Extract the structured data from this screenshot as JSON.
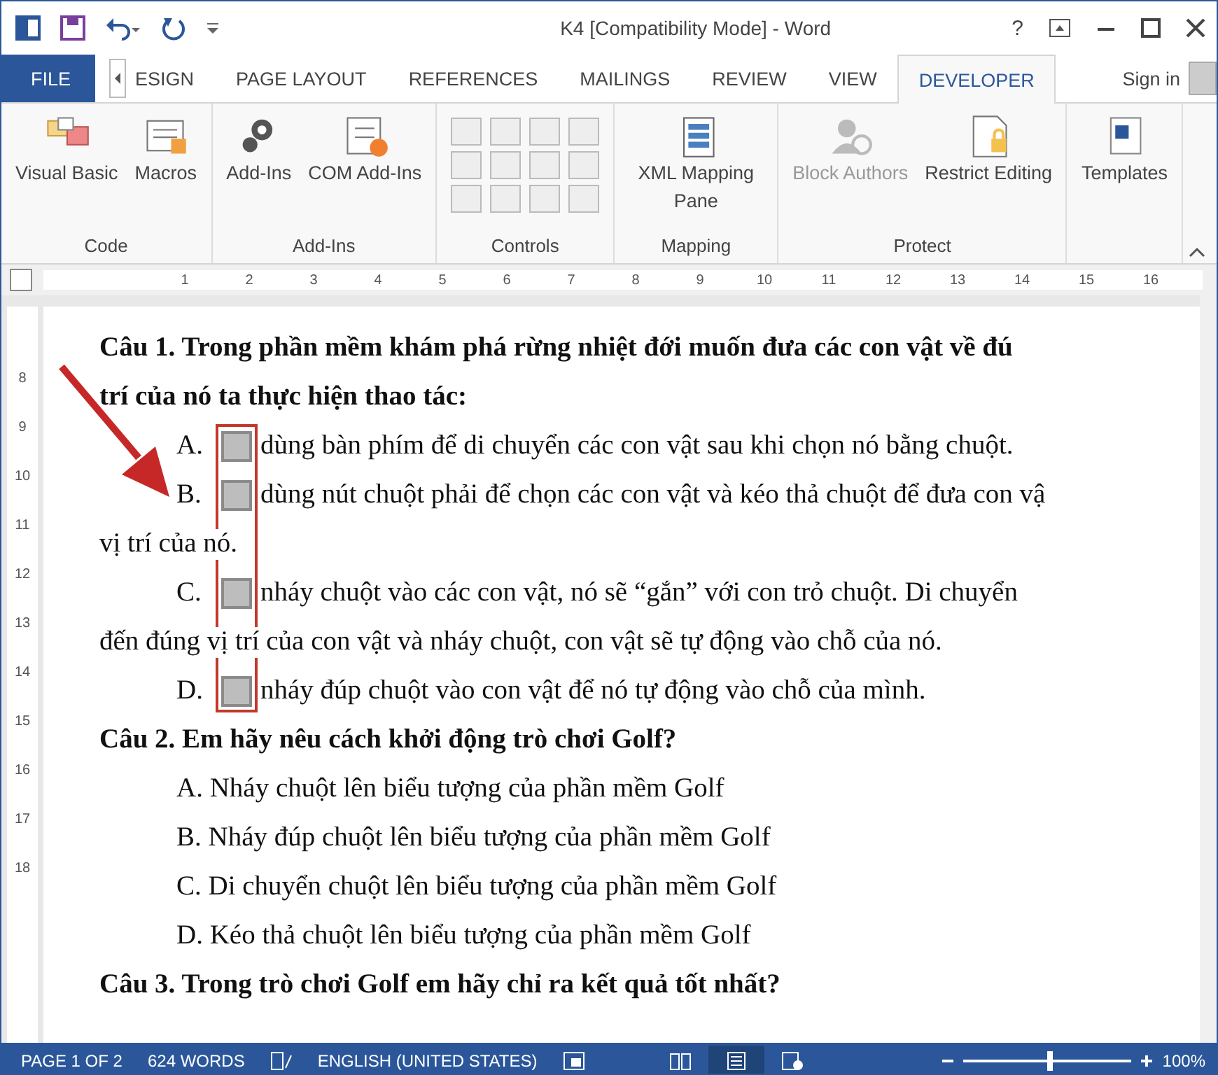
{
  "window": {
    "title": "K4 [Compatibility Mode] - Word",
    "help": "?"
  },
  "tabs": [
    {
      "label": "FILE",
      "kind": "file",
      "selected": false
    },
    {
      "label": "ESIGN",
      "kind": "scrolled",
      "selected": false
    },
    {
      "label": "PAGE LAYOUT",
      "kind": "tab",
      "selected": false
    },
    {
      "label": "REFERENCES",
      "kind": "tab",
      "selected": false
    },
    {
      "label": "MAILINGS",
      "kind": "tab",
      "selected": false
    },
    {
      "label": "REVIEW",
      "kind": "tab",
      "selected": false
    },
    {
      "label": "VIEW",
      "kind": "tab",
      "selected": false
    },
    {
      "label": "DEVELOPER",
      "kind": "tab",
      "selected": true
    }
  ],
  "sign_in": "Sign in",
  "ribbon": {
    "groups": [
      {
        "label": "Code",
        "buttons": [
          {
            "label": "Visual Basic",
            "disabled": false
          },
          {
            "label": "Macros",
            "disabled": false
          }
        ]
      },
      {
        "label": "Add-Ins",
        "buttons": [
          {
            "label": "Add-Ins",
            "disabled": false
          },
          {
            "label": "COM Add-Ins",
            "disabled": false
          }
        ]
      },
      {
        "label": "Controls"
      },
      {
        "label": "Mapping",
        "buttons": [
          {
            "label": "XML Mapping Pane",
            "disabled": false
          }
        ]
      },
      {
        "label": "Protect",
        "buttons": [
          {
            "label": "Block Authors",
            "disabled": true
          },
          {
            "label": "Restrict Editing",
            "disabled": false
          }
        ]
      },
      {
        "buttons": [
          {
            "label": "Templates",
            "disabled": false
          }
        ]
      }
    ]
  },
  "ruler": {
    "ticks": [
      "1",
      "2",
      "3",
      "4",
      "5",
      "6",
      "7",
      "8",
      "9",
      "10",
      "11",
      "12",
      "13",
      "14",
      "15",
      "16"
    ]
  },
  "vertical_ruler": {
    "ticks": [
      "8",
      "9",
      "10",
      "11",
      "12",
      "13",
      "14",
      "15",
      "16",
      "17",
      "18"
    ]
  },
  "document": {
    "lines": [
      {
        "kind": "heading",
        "text": "Câu 1. Trong phần mềm khám phá rừng nhiệt đới muốn đưa các con vật về đú"
      },
      {
        "kind": "heading",
        "text": "trí của nó ta thực hiện thao tác:"
      },
      {
        "kind": "option",
        "letter": "A.",
        "checked": false,
        "text": "dùng bàn phím để di chuyển các con vật sau khi chọn nó bằng chuột."
      },
      {
        "kind": "option",
        "letter": "B.",
        "checked": false,
        "text": "dùng nút chuột phải để chọn các con vật và kéo thả chuột để đưa con vậ"
      },
      {
        "kind": "text",
        "text": "vị trí của nó."
      },
      {
        "kind": "option",
        "letter": "C.",
        "checked": false,
        "text": "nháy chuột vào các con vật, nó sẽ “gắn” với con trỏ chuột. Di chuyển"
      },
      {
        "kind": "text",
        "text": "đến đúng vị trí của con vật và nháy chuột, con vật sẽ tự động vào chỗ của nó."
      },
      {
        "kind": "option",
        "letter": "D.",
        "checked": false,
        "text": "nháy đúp chuột vào con vật để nó tự động vào chỗ của mình."
      },
      {
        "kind": "heading",
        "text": "Câu 2. Em hãy nêu cách khởi động trò chơi Golf?"
      },
      {
        "kind": "indent",
        "text": "A. Nháy chuột lên biểu tượng của phần mềm Golf"
      },
      {
        "kind": "indent",
        "text": "B. Nháy đúp chuột lên biểu tượng của phần mềm Golf"
      },
      {
        "kind": "indent",
        "text": "C. Di chuyển chuột lên biểu tượng của phần mềm Golf"
      },
      {
        "kind": "indent",
        "text": "D. Kéo thả chuột lên biểu tượng của phần mềm Golf"
      },
      {
        "kind": "heading",
        "text": "Câu 3. Trong trò chơi Golf em hãy chỉ ra kết quả tốt nhất?"
      }
    ]
  },
  "status_bar": {
    "page": "PAGE 1 OF 2",
    "words": "624 WORDS",
    "language": "ENGLISH (UNITED STATES)",
    "zoom": "100%",
    "zoom_level": {
      "level": 0.5
    }
  }
}
